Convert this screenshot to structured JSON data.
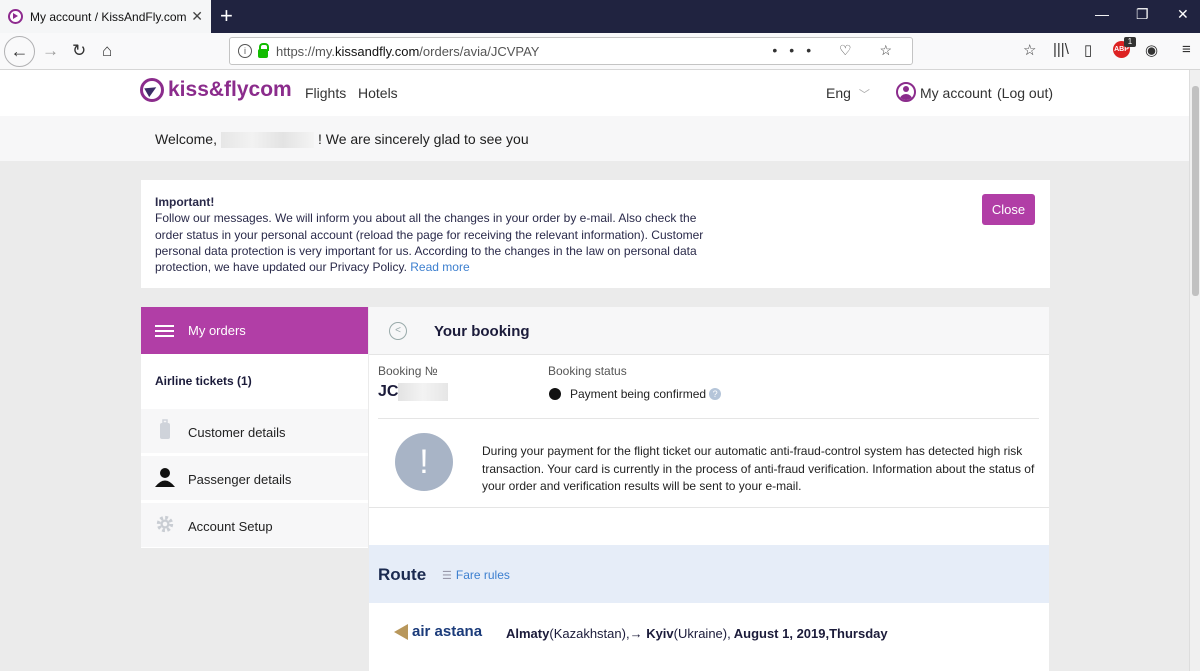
{
  "browser": {
    "tab_title": "My account / KissAndFly.com",
    "url_prefix": "https://my.",
    "url_domain": "kissandfly.com",
    "url_path": "/orders/avia/JCVPAY",
    "abp_label": "ABP",
    "abp_count": "1"
  },
  "header": {
    "logo_text": "kiss&flycom",
    "nav": [
      "Flights",
      "Hotels"
    ],
    "lang": "Eng",
    "account": "My account",
    "logout": "(Log out)"
  },
  "welcome": {
    "before": "Welcome,",
    "after": "! We are sincerely glad to see you"
  },
  "notice": {
    "title": "Important!",
    "body": "Follow our messages. We will inform you about all the changes in your order by e-mail. Also check the order status in your personal account (reload the page for receiving the relevant information). Customer personal data protection is very important for us. According to the changes in the law on personal data protection, we have updated our Privacy Policy.",
    "link": "Read more",
    "close": "Close"
  },
  "sidebar": {
    "active": "My orders",
    "subheading": "Airline tickets (1)",
    "items": [
      "Customer details",
      "Passenger details",
      "Account Setup"
    ]
  },
  "booking": {
    "title": "Your booking",
    "number_label": "Booking №",
    "number_prefix": "JC",
    "status_label": "Booking status",
    "status": "Payment being confirmed",
    "help": "?",
    "warning_symbol": "!",
    "warning": "During your payment for the flight ticket our automatic anti-fraud-control system has detected high risk transaction. Your card is currently in the process of anti-fraud verification. Information about the status of your order and verification results will be sent to your e-mail."
  },
  "route": {
    "title": "Route",
    "fare_rules": "Fare rules",
    "airline": "air astana",
    "from_city": "Almaty",
    "from_country": "(Kazakhstan),",
    "arrow": "→",
    "to_city": "Kyiv",
    "to_country": "(Ukraine),",
    "date": "August 1, 2019,Thursday"
  }
}
